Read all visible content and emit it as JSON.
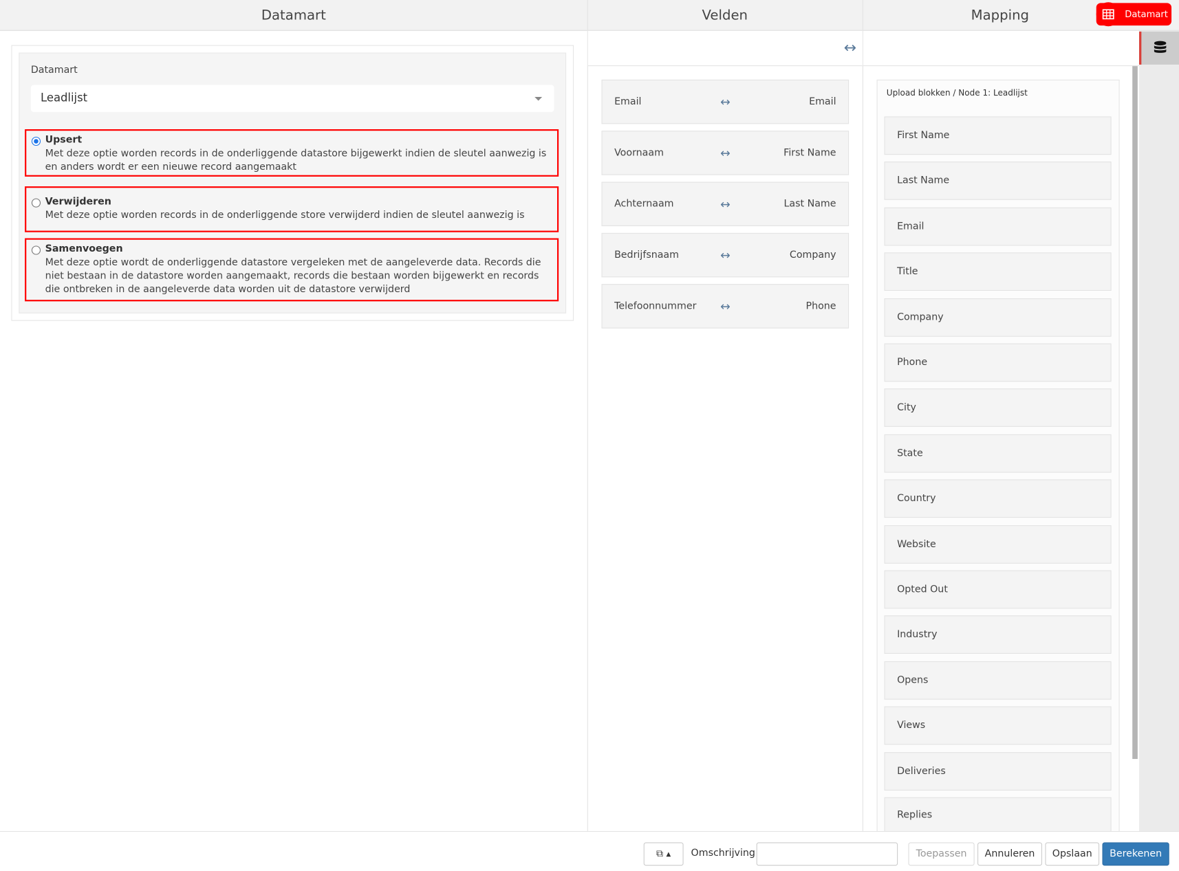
{
  "header": {
    "col1": "Datamart",
    "col2": "Velden",
    "col3": "Mapping",
    "badge": "Datamart",
    "badge_icon": "table-icon"
  },
  "datamart": {
    "label": "Datamart",
    "selected": "Leadlijst",
    "options": [
      {
        "title": "Upsert",
        "desc": "Met deze optie worden records in de onderliggende datastore bijgewerkt indien de sleutel aanwezig is en anders wordt er een nieuwe record aangemaakt",
        "checked": true
      },
      {
        "title": "Verwijderen",
        "desc": "Met deze optie worden records in de onderliggende store verwijderd indien de sleutel aanwezig is",
        "checked": false
      },
      {
        "title": "Samenvoegen",
        "desc": "Met deze optie wordt de onderliggende datastore vergeleken met de aangeleverde data. Records die niet bestaan in de datastore worden aangemaakt, records die bestaan worden bijgewerkt en records die ontbreken in de aangeleverde data worden uit de datastore verwijderd",
        "checked": false
      }
    ]
  },
  "velden": {
    "rows": [
      {
        "left": "Email",
        "right": "Email"
      },
      {
        "left": "Voornaam",
        "right": "First Name"
      },
      {
        "left": "Achternaam",
        "right": "Last Name"
      },
      {
        "left": "Bedrijfsnaam",
        "right": "Company"
      },
      {
        "left": "Telefoonnummer",
        "right": "Phone"
      }
    ],
    "arrow": "↔"
  },
  "mapping": {
    "title": "Upload blokken / Node 1: Leadlijst",
    "items": [
      "First Name",
      "Last Name",
      "Email",
      "Title",
      "Company",
      "Phone",
      "City",
      "State",
      "Country",
      "Website",
      "Opted Out",
      "Industry",
      "Opens",
      "Views",
      "Deliveries",
      "Replies"
    ]
  },
  "footer": {
    "desc_label": "Omschrijving",
    "desc_value": "",
    "apply": "Toepassen",
    "cancel": "Annuleren",
    "save": "Opslaan",
    "compute": "Berekenen"
  },
  "colors": {
    "accent": "#337ab7",
    "badge": "#ff0000",
    "highlight": "#ff0000"
  }
}
